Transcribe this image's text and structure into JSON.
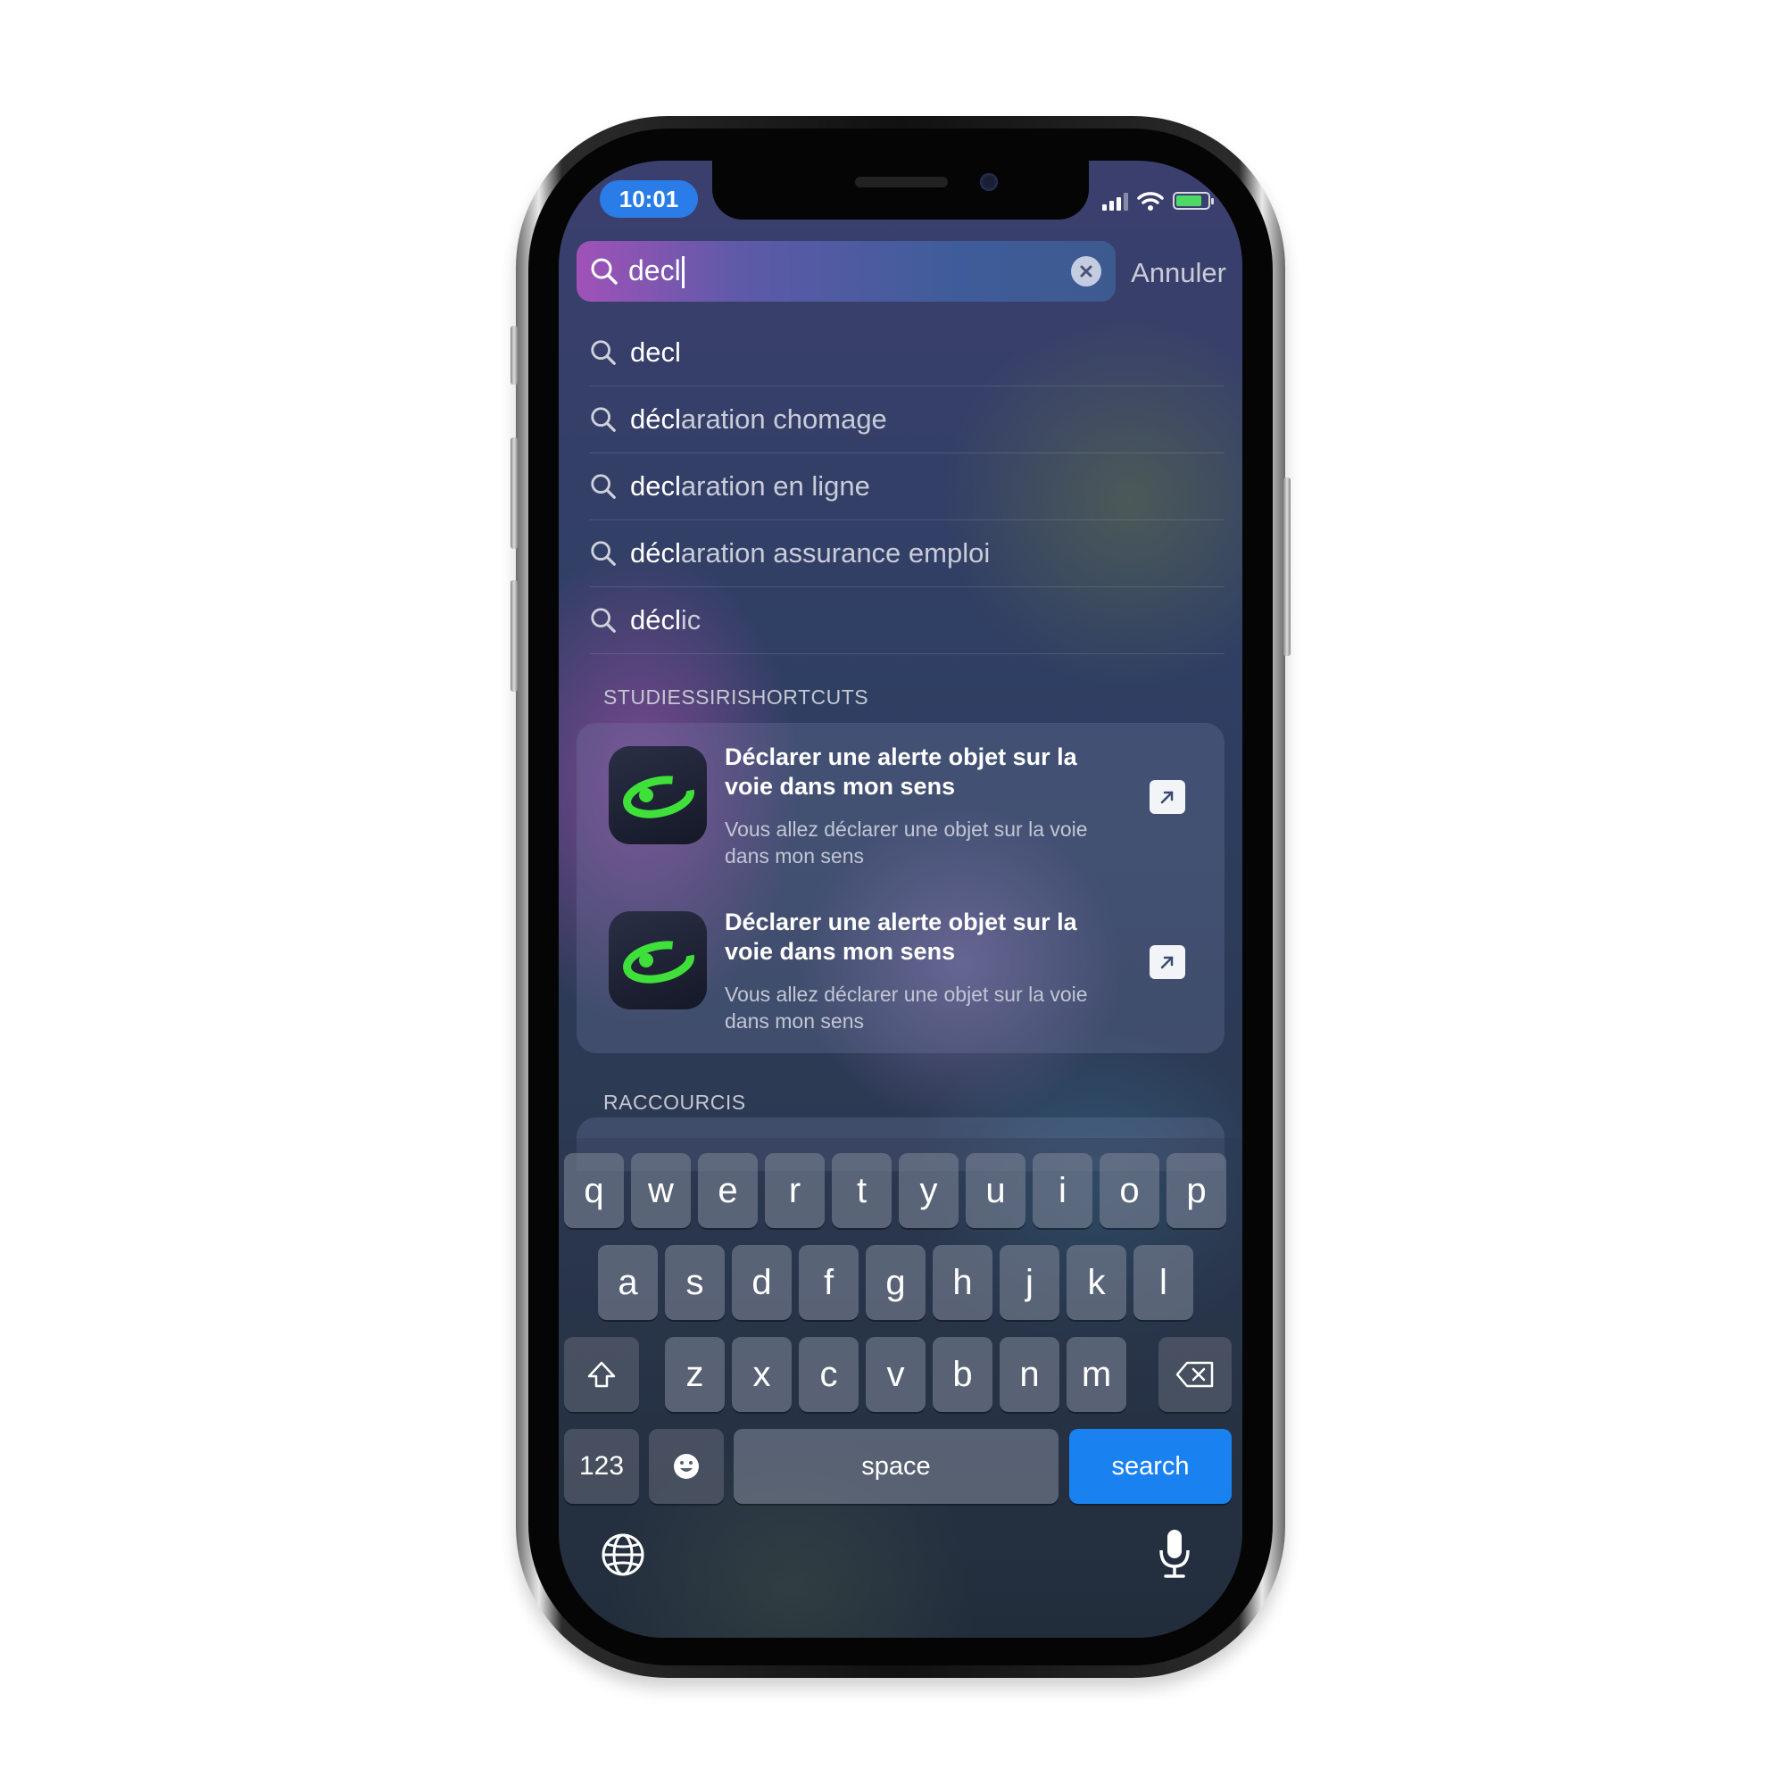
{
  "status_bar": {
    "time": "10:01"
  },
  "search": {
    "query": "decl",
    "cancel_label": "Annuler"
  },
  "suggestions": [
    {
      "match": "decl",
      "rest": ""
    },
    {
      "match": "décl",
      "rest": "aration chomage"
    },
    {
      "match": "decl",
      "rest": "aration en ligne"
    },
    {
      "match": "décl",
      "rest": "aration assurance emploi"
    },
    {
      "match": "décl",
      "rest": "ic"
    }
  ],
  "sections": {
    "shortcuts_app": {
      "label": "STUDIESSIRISHORTCUTS",
      "items": [
        {
          "title": "Déclarer une alerte objet sur la voie dans mon sens",
          "subtitle": "Vous allez déclarer une objet sur la voie dans mon sens"
        },
        {
          "title": "Déclarer une alerte objet sur la voie dans mon sens",
          "subtitle": "Vous allez déclarer une objet sur la voie dans mon sens"
        }
      ]
    },
    "raccourcis": {
      "label": "RACCOURCIS"
    }
  },
  "keyboard": {
    "row1": [
      "q",
      "w",
      "e",
      "r",
      "t",
      "y",
      "u",
      "i",
      "o",
      "p"
    ],
    "row2": [
      "a",
      "s",
      "d",
      "f",
      "g",
      "h",
      "j",
      "k",
      "l"
    ],
    "row3": [
      "z",
      "x",
      "c",
      "v",
      "b",
      "n",
      "m"
    ],
    "numbers_label": "123",
    "space_label": "space",
    "search_label": "search"
  },
  "colors": {
    "accent": "#1a82f0",
    "time_pill": "#2a7de8",
    "app_icon_green": "#3fe03a"
  },
  "icons": [
    "search-icon",
    "clear-icon",
    "signal-icon",
    "wifi-icon",
    "battery-icon",
    "arrow-up-right-icon",
    "shift-icon",
    "delete-icon",
    "emoji-icon",
    "globe-icon",
    "microphone-icon"
  ]
}
